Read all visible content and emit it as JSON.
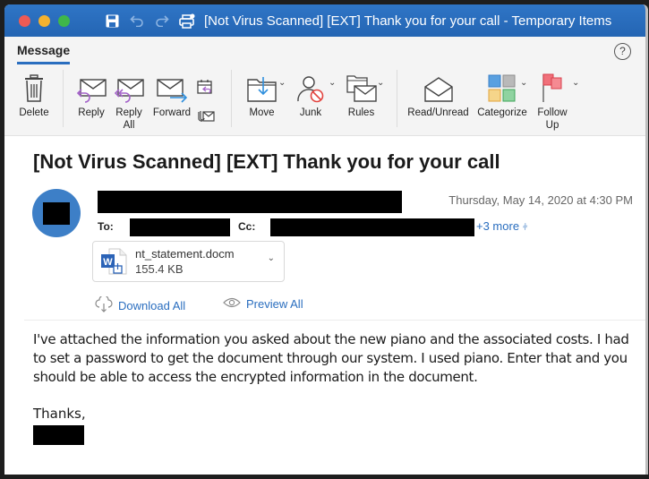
{
  "window": {
    "title": "[Not Virus Scanned] [EXT] Thank you for your call - Temporary Items",
    "accent_color": "#2a6ebf"
  },
  "ribbon": {
    "active_tab": "Message",
    "help_label": "?",
    "buttons": [
      {
        "id": "delete",
        "label": "Delete",
        "icon": "trash-icon"
      },
      {
        "id": "reply",
        "label": "Reply",
        "icon": "reply-icon"
      },
      {
        "id": "reply-all",
        "label": "Reply\nAll",
        "icon": "reply-all-icon"
      },
      {
        "id": "forward",
        "label": "Forward",
        "icon": "forward-icon"
      },
      {
        "id": "meeting-reply",
        "label": "",
        "icon": "calendar-reply-icon"
      },
      {
        "id": "attach",
        "label": "",
        "icon": "attachment-mail-icon"
      },
      {
        "id": "move",
        "label": "Move",
        "icon": "move-folder-icon"
      },
      {
        "id": "junk",
        "label": "Junk",
        "icon": "junk-icon"
      },
      {
        "id": "rules",
        "label": "Rules",
        "icon": "rules-icon"
      },
      {
        "id": "read-unread",
        "label": "Read/Unread",
        "icon": "open-envelope-icon"
      },
      {
        "id": "categorize",
        "label": "Categorize",
        "icon": "categorize-icon"
      },
      {
        "id": "follow-up",
        "label": "Follow\nUp",
        "icon": "flag-icon"
      }
    ],
    "labels": {
      "delete": "Delete",
      "reply": "Reply",
      "reply_all_1": "Reply",
      "reply_all_2": "All",
      "forward": "Forward",
      "move": "Move",
      "junk": "Junk",
      "rules": "Rules",
      "read_unread": "Read/Unread",
      "categorize": "Categorize",
      "follow_up_1": "Follow",
      "follow_up_2": "Up"
    }
  },
  "email": {
    "subject": "[Not Virus Scanned] [EXT] Thank you for your call",
    "date": "Thursday, May 14, 2020 at 4:30 PM",
    "to_label": "To:",
    "cc_label": "Cc:",
    "more_recipients": "+3 more",
    "attachment": {
      "name": "nt_statement.docm",
      "size": "155.4 KB",
      "type_icon": "word-doc-icon"
    },
    "actions": {
      "download_all": "Download All",
      "preview_all": "Preview All"
    },
    "body": [
      "I've attached the information you asked about the new piano and the associated costs. I had to set a password to get the document through our system. I used piano. Enter that and you should be able to access the encrypted information in the document."
    ],
    "signoff": "Thanks,"
  }
}
